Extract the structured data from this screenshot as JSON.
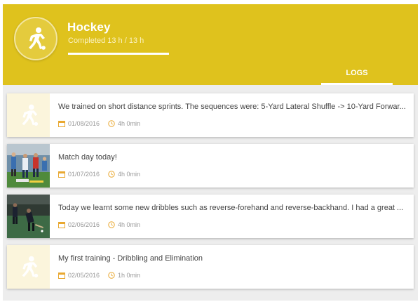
{
  "colors": {
    "accent": "#dfc21d",
    "background": "#ededed",
    "placeholder_bg": "#fbf5dc",
    "icon_orange": "#e9a830"
  },
  "header": {
    "title": "Hockey",
    "subtitle": "Completed 13 h / 13 h",
    "progress_fraction": 1.0,
    "logo_icon": "athlete-icon"
  },
  "tabs": {
    "logs_label": "LOGS"
  },
  "logs": [
    {
      "text": "We trained on short distance sprints. The sequences were: 5-Yard Lateral Shuffle -> 10-Yard Forwar...",
      "date": "01/08/2016",
      "duration": "4h 0min",
      "thumbnail": "athlete-placeholder"
    },
    {
      "text": "Match day today!",
      "date": "01/07/2016",
      "duration": "4h 0min",
      "thumbnail": "match-photo"
    },
    {
      "text": "Today we learnt some new dribbles such as reverse-forehand and reverse-backhand. I had a great ...",
      "date": "02/06/2016",
      "duration": "4h 0min",
      "thumbnail": "training-photo"
    },
    {
      "text": "My first training - Dribbling and Elimination",
      "date": "02/05/2016",
      "duration": "1h 0min",
      "thumbnail": "athlete-placeholder"
    }
  ]
}
